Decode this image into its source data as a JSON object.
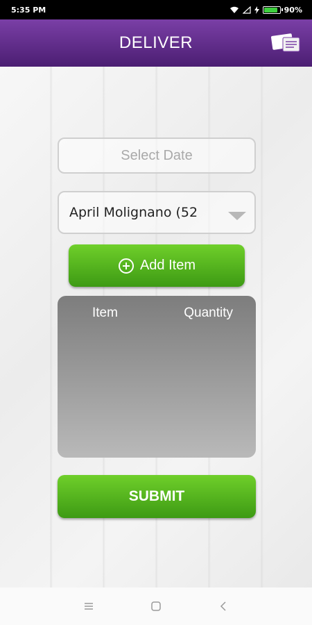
{
  "status_bar": {
    "time": "5:35 PM",
    "battery_text": "90%",
    "battery_level": 0.9,
    "icons": [
      "wifi-icon",
      "signal-icon",
      "charging-icon",
      "battery-icon"
    ]
  },
  "app_bar": {
    "title": "DELIVER",
    "logo_icon": "app-logo-icon",
    "color_top": "#7a3fa6",
    "color_bottom": "#4b1e72"
  },
  "form": {
    "date_placeholder": "Select Date",
    "customer_selected": "April Molignano (52",
    "add_item_label": "Add Item",
    "submit_label": "SUBMIT"
  },
  "table": {
    "columns": [
      "Item",
      "Quantity"
    ],
    "rows": []
  },
  "colors": {
    "button_green": "#4cae1c"
  },
  "nav_bar": {
    "icons": [
      "menu-icon",
      "home-icon",
      "back-icon"
    ]
  }
}
